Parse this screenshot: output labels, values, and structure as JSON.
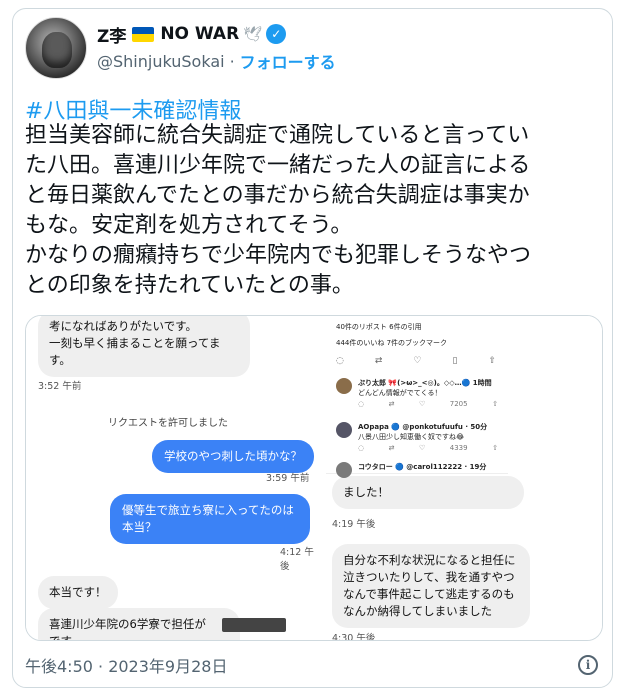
{
  "author": {
    "display_name": "Z李",
    "badge_text": "NO WAR",
    "handle": "@ShinjukuSokai",
    "separator": "·",
    "follow_label": "フォローする"
  },
  "icons": {
    "avatar": "avatar-image",
    "flag": "ukraine-flag-icon",
    "dove": "dove-icon",
    "verified": "verified-badge-icon",
    "logo": "x-logo-icon",
    "info": "info-icon"
  },
  "colors": {
    "link": "#1d9bf0",
    "text": "#0f1419",
    "muted": "#536471",
    "bubble_blue": "#3b82f6",
    "bubble_gray": "#efefef"
  },
  "tweet": {
    "hashtag": "#八田與一未確認情報",
    "body": "担当美容師に統合失調症で通院していると言ってい\nた八田。喜連川少年院で一緒だった人の証言による\nと毎日薬飲んでたとの事だから統合失調症は事実か\nもな。安定剤を処方されてそう。\nかなりの癇癪持ちで少年院内でも犯罪しそうなやつ\nとの印象を持たれていたとの事。",
    "timestamp": "午後4:50 · 2023年9月28日"
  },
  "media": {
    "left_chat": {
      "msg1": "考になればありがたいです。\n一刻も早く捕まることを願ってま\nす。",
      "ts1": "3:52 午前",
      "system_notice": "リクエストを許可しました",
      "q1": "学校のやつ刺した頃かな？",
      "ts_q1": "3:59 午前",
      "q2": "優等生で旅立ち寮に入ってたのは\n本当？",
      "ts_q2": "4:12 午後",
      "a1": "本当です！",
      "a2": "喜連川少年院の6学寮で担任が\nです"
    },
    "right_chat": {
      "msg_partial": "ました！",
      "ts1": "4:19 午後",
      "msg2": "自分な不利な状況になると担任に\n泣きついたりして、我を通すやつ\nなんで事件起こして逃走するのも\nなんか納得してしまいました",
      "ts2": "4:30 午後"
    },
    "overlay": {
      "stats1": "40件のリポスト  6件の引用",
      "stats2": "444件のいいね  7件のブックマーク",
      "replies": [
        {
          "name": "ぷり太郎 🎀(>ω>_<◎)。◇◇…🔵 1時間",
          "text": "どんどん情報がでてくる！",
          "count": "7205"
        },
        {
          "name": "AOpapa 🔵 @ponkotufuufu · 50分",
          "text": "八景八田少し知恵働く奴ですね😂",
          "count": "4339"
        },
        {
          "name": "コウタロー 🔵 @carol112222 · 19分",
          "text": "",
          "count": ""
        }
      ]
    }
  }
}
